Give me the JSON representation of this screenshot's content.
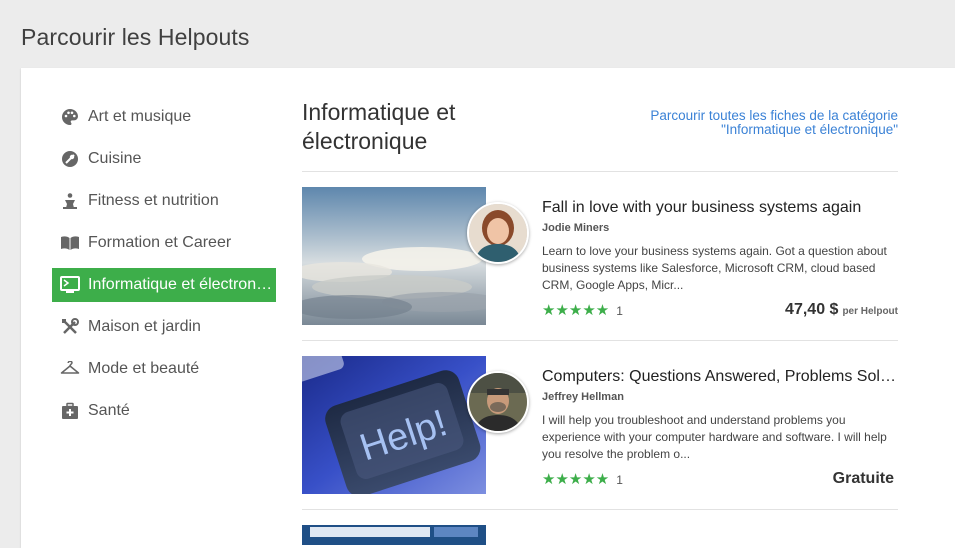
{
  "page_title": "Parcourir les Helpouts",
  "sidebar": {
    "items": [
      {
        "label": "Art et musique",
        "icon": "palette-icon",
        "active": false
      },
      {
        "label": "Cuisine",
        "icon": "cooking-icon",
        "active": false
      },
      {
        "label": "Fitness et nutrition",
        "icon": "fitness-icon",
        "active": false
      },
      {
        "label": "Formation et Career",
        "icon": "book-icon",
        "active": false
      },
      {
        "label": "Informatique et électron…",
        "icon": "computer-icon",
        "active": true
      },
      {
        "label": "Maison et jardin",
        "icon": "tools-icon",
        "active": false
      },
      {
        "label": "Mode et beauté",
        "icon": "hanger-icon",
        "active": false
      },
      {
        "label": "Santé",
        "icon": "medical-kit-icon",
        "active": false
      }
    ]
  },
  "category": {
    "title_line1": "Informatique et",
    "title_line2": "électronique",
    "browse_link_line1": "Parcourir toutes les fiches de la catégorie",
    "browse_link_line2": "\"Informatique et électronique\""
  },
  "listings": [
    {
      "title": "Fall in love with your business systems again",
      "author": "Jodie Miners",
      "description": "Learn to love your business systems again. Got a question about business systems like Salesforce, Microsoft CRM, cloud based CRM, Google Apps, Micr...",
      "stars": "★★★★★",
      "rating": 5,
      "review_count": "1",
      "price": "47,40 $",
      "price_unit": "per Helpout"
    },
    {
      "title": "Computers: Questions Answered, Problems Solved",
      "author": "Jeffrey Hellman",
      "description": "I will help you troubleshoot and understand problems you experience with your computer hardware and software. I will help you resolve the problem o...",
      "stars": "★★★★★",
      "rating": 5,
      "review_count": "1",
      "price": "Gratuite",
      "price_unit": ""
    }
  ],
  "colors": {
    "accent_green": "#3dae4a",
    "link_blue": "#3b82d6"
  }
}
